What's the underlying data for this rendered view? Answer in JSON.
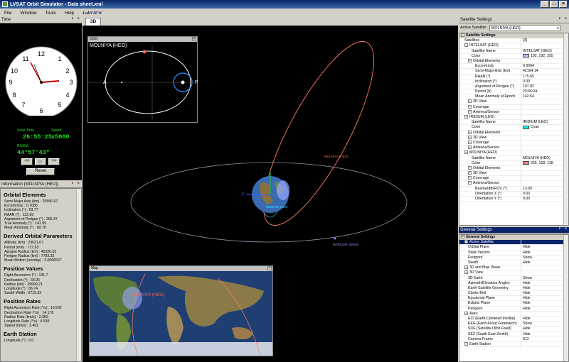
{
  "window": {
    "title": "LVSAT Orbit Simulator - Data sheet.xml",
    "min": "_",
    "max": "□",
    "close": "×"
  },
  "menu": {
    "items": [
      "File",
      "Window",
      "Tools",
      "Help"
    ],
    "logo": "LabVIEW"
  },
  "time_panel": {
    "title": "Time",
    "solar_time_label": "Solar Time",
    "solar_time": "26:55:25",
    "speed_label": "Speed",
    "speed": "x5000",
    "rasim_label": "RASIM",
    "rasim": "44°57'43\"",
    "btn_rewind": "<<",
    "btn_play": "▷",
    "btn_forward": ">>",
    "btn_reset": "Reset"
  },
  "info_panel": {
    "title": "Information (MOLNIYA (HEO))",
    "orbital_elements": {
      "heading": "Orbital Elements",
      "lines": [
        "Semi-Major Axis (km) : 26556.67",
        "Eccentricity : 0.7085",
        "Inclination (°) : 63.77",
        "RAAN (°) : 112.99",
        "Argument of Perigee (°) : 255.47",
        "True Anomaly (°) : 141.99",
        "Mean Anomaly (°) : 69.78"
      ]
    },
    "derived": {
      "heading": "Derived Orbital Parameters",
      "lines": [
        "Altitude (km) : 23621.07",
        "Period (min) : 717.63",
        "Apogee Radius (km) : 45320.02",
        "Perigee Radius (km) : 7793.32",
        "Mean Motion (rev/day) : 2.0066527"
      ]
    },
    "position": {
      "heading": "Position Values",
      "lines": [
        "Right Ascension (°) : 131.7",
        "Declination (°) : 33.06",
        "Radius (km) : 29999.21",
        "Longitude (°) : 86.74",
        "Swath Width : 5715.32"
      ]
    },
    "rates": {
      "heading": "Position Rates",
      "lines": [
        "Right Ascension Rate (°/s) : 10.502",
        "Declination Rate (°/s) : 14.178",
        "Radius Rate (km/s) : 2.382",
        "Longitude Rate (°/s) : 4.539",
        "Speed (km/s) : 3.401"
      ]
    },
    "earth_station": {
      "heading": "Earth Station",
      "lines": [
        "Longitude (°) : 0.0"
      ]
    }
  },
  "tab": {
    "label": "3D"
  },
  "orbit_window": {
    "title": "Orbit",
    "sat_name": "MOLNIYA (HEO)",
    "apogee": "A",
    "perigee": "P"
  },
  "scene": {
    "molniya_label": "MOLNIYA (HEO)",
    "intelsat_label": "INTELSAT (GEO)",
    "iridium_label": "IRIDIUM (LEO)",
    "axis_y": "Y",
    "molniya_color": "#ff8060",
    "leo_color": "#40e0ff"
  },
  "map_window": {
    "title": "Map",
    "sat_label": "MOLNIYA (HEO)"
  },
  "sat_settings": {
    "title": "Satellite Settings",
    "active_label": "Active Satellite:",
    "active_value": "MOLNIYA (HEO)",
    "rows": [
      {
        "indent": 0,
        "sec": true,
        "k": "Satellite Settings",
        "v": ""
      },
      {
        "indent": 1,
        "k": "Satellites",
        "v": "[3]"
      },
      {
        "indent": 1,
        "k": "INTELSAT (GEO)",
        "v": ""
      },
      {
        "indent": 3,
        "k": "Satellite Name",
        "v": "INTELSAT (GEO)"
      },
      {
        "indent": 3,
        "k": "Color",
        "v": "192, 192, 255",
        "sw": "#c0c0ff"
      },
      {
        "indent": 2,
        "k": "Orbital Elements",
        "v": ""
      },
      {
        "indent": 4,
        "k": "Eccentricity",
        "v": "0.0004"
      },
      {
        "indent": 4,
        "k": "Semi-Major Axis (km)",
        "v": "42164.14"
      },
      {
        "indent": 4,
        "k": "RAAN (°)",
        "v": "175.65"
      },
      {
        "indent": 4,
        "k": "Inclination (°)",
        "v": "0.00"
      },
      {
        "indent": 4,
        "k": "Argument of Perigee (°)",
        "v": "107.82"
      },
      {
        "indent": 4,
        "k": "Period (h)",
        "v": "23:56:04"
      },
      {
        "indent": 4,
        "k": "Mean Anomaly at Epoch",
        "v": "142.54"
      },
      {
        "indent": 2,
        "k": "3D View",
        "v": ""
      },
      {
        "indent": 2,
        "k": "Coverage",
        "v": ""
      },
      {
        "indent": 2,
        "k": "Antenna/Sensor",
        "v": ""
      },
      {
        "indent": 1,
        "k": "IRIDIUM (LEO)",
        "v": ""
      },
      {
        "indent": 3,
        "k": "Satellite Name",
        "v": "IRIDIUM (LEO)"
      },
      {
        "indent": 3,
        "k": "Color",
        "v": "Cyan",
        "sw": "#00ffff"
      },
      {
        "indent": 2,
        "k": "Orbital Elements",
        "v": ""
      },
      {
        "indent": 2,
        "k": "3D View",
        "v": ""
      },
      {
        "indent": 2,
        "k": "Coverage",
        "v": ""
      },
      {
        "indent": 2,
        "k": "Antenna/Sensor",
        "v": ""
      },
      {
        "indent": 1,
        "k": "MOLNIYA (HEO)",
        "v": ""
      },
      {
        "indent": 3,
        "k": "Satellite Name",
        "v": "MOLNIYA (HEO)"
      },
      {
        "indent": 3,
        "k": "Color",
        "v": "255, 128, 128",
        "sw": "#ff8080"
      },
      {
        "indent": 2,
        "k": "Orbital Elements",
        "v": ""
      },
      {
        "indent": 2,
        "k": "3D View",
        "v": ""
      },
      {
        "indent": 2,
        "k": "Coverage",
        "v": ""
      },
      {
        "indent": 2,
        "k": "Antenna/Sensor",
        "v": ""
      },
      {
        "indent": 4,
        "k": "Beamwidth/FOV (°)",
        "v": "13.00"
      },
      {
        "indent": 4,
        "k": "Orientation X (°)",
        "v": "0.00"
      },
      {
        "indent": 4,
        "k": "Orientation Y (°)",
        "v": "0.00"
      }
    ]
  },
  "gen_settings": {
    "title": "General Settings",
    "rows": [
      {
        "indent": 0,
        "sec": true,
        "k": "General Settings",
        "v": ""
      },
      {
        "indent": 1,
        "sel": true,
        "k": "Active Satellite",
        "v": ""
      },
      {
        "indent": 2,
        "k": "Orbital Plane",
        "v": "Hide"
      },
      {
        "indent": 2,
        "k": "State Vectors",
        "v": "Hide"
      },
      {
        "indent": 2,
        "k": "Footprint",
        "v": "Show"
      },
      {
        "indent": 2,
        "k": "Swath",
        "v": "Hide"
      },
      {
        "indent": 1,
        "k": "3D and Map Views",
        "v": ""
      },
      {
        "indent": 1,
        "k": "3D View",
        "v": ""
      },
      {
        "indent": 2,
        "k": "3D Earth",
        "v": "Show"
      },
      {
        "indent": 2,
        "k": "Azimuth/Elevation Angles",
        "v": "Hide"
      },
      {
        "indent": 2,
        "k": "Earth-Satellite Geometry",
        "v": "Hide"
      },
      {
        "indent": 2,
        "k": "Clarke Belt",
        "v": "Hide"
      },
      {
        "indent": 2,
        "k": "Equatorial Plane",
        "v": "Hide"
      },
      {
        "indent": 2,
        "k": "Ecliptic Plane",
        "v": "Hide"
      },
      {
        "indent": 2,
        "k": "Perigees",
        "v": "Hide"
      },
      {
        "indent": 1,
        "k": "Axes",
        "v": ""
      },
      {
        "indent": 2,
        "k": "ECI (Earth-Centered Inertial)",
        "v": "Hide"
      },
      {
        "indent": 2,
        "k": "EFG (Earth-Fixed Greenwich)",
        "v": "Show"
      },
      {
        "indent": 2,
        "k": "SOF (Satellite-Orbit Fixed)",
        "v": "Hide"
      },
      {
        "indent": 2,
        "k": "SEZ (South East Zenith)",
        "v": "Hide"
      },
      {
        "indent": 2,
        "k": "Camera Frame",
        "v": "ECI"
      },
      {
        "indent": 1,
        "k": "Earth Station",
        "v": ""
      }
    ]
  }
}
